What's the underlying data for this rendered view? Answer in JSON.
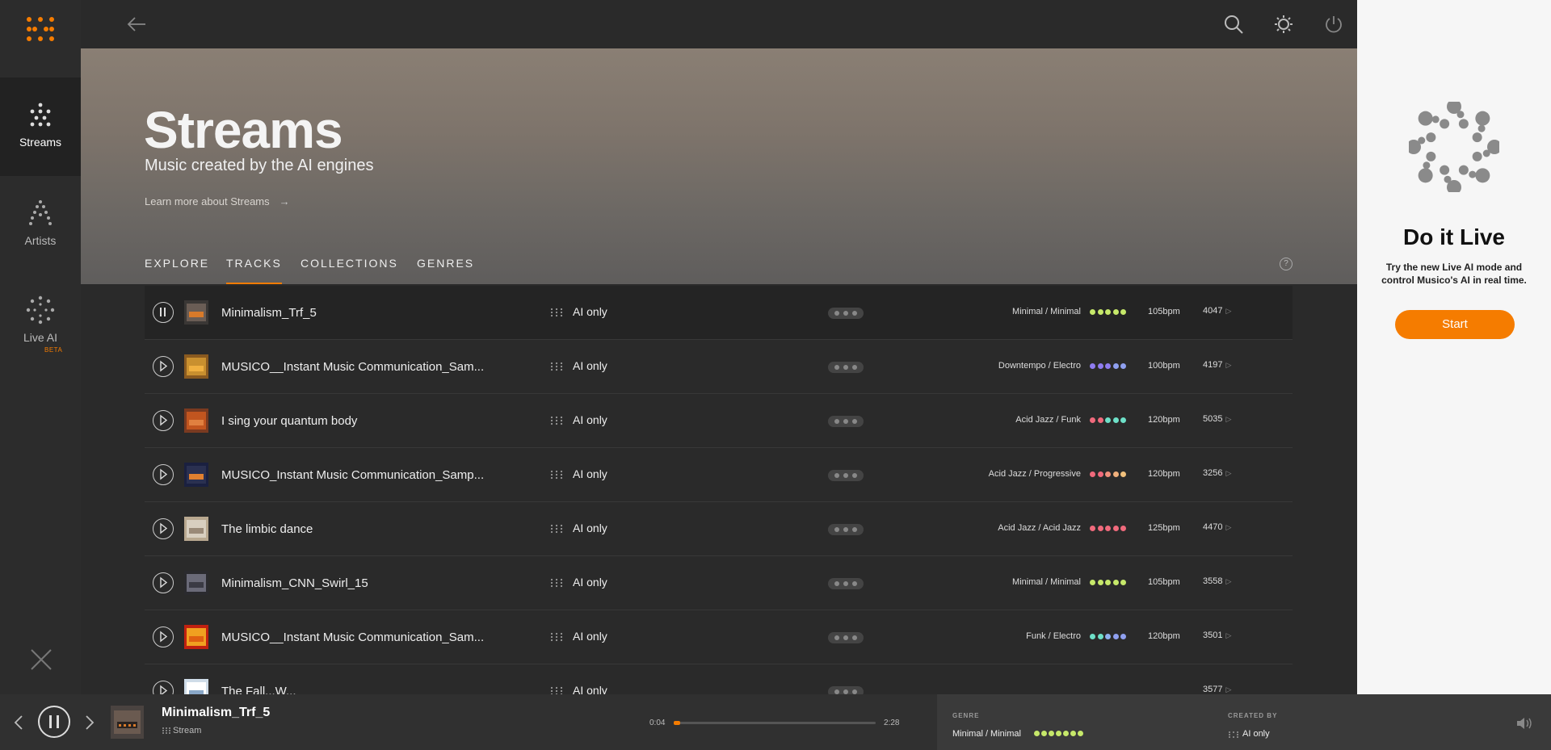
{
  "rail": {
    "items": [
      {
        "label": "Streams"
      },
      {
        "label": "Artists"
      },
      {
        "label": "Live AI",
        "badge": "BETA"
      }
    ]
  },
  "hero": {
    "title": "Streams",
    "subtitle": "Music created by the AI engines",
    "learn_more": "Learn more about Streams",
    "help": "?",
    "tabs": [
      {
        "label": "EXPLORE"
      },
      {
        "label": "TRACKS",
        "active": true
      },
      {
        "label": "COLLECTIONS"
      },
      {
        "label": "GENRES"
      }
    ]
  },
  "tracks": [
    {
      "title": "Minimalism_Trf_5",
      "creator": "AI only",
      "genre": "Minimal / Minimal",
      "colors": [
        "#c6e86a",
        "#c6e86a",
        "#c6e86a",
        "#c6e86a",
        "#c6e86a"
      ],
      "bpm": "105bpm",
      "plays": "4047",
      "playing": true
    },
    {
      "title": "MUSICO__Instant Music Communication_Sam...",
      "creator": "AI only",
      "genre": "Downtempo / Electro",
      "colors": [
        "#8f7cf0",
        "#8f7cf0",
        "#8f7cf0",
        "#8fa0f0",
        "#8fa0f0"
      ],
      "bpm": "100bpm",
      "plays": "4197"
    },
    {
      "title": "I sing your quantum body",
      "creator": "AI only",
      "genre": "Acid Jazz / Funk",
      "colors": [
        "#f06a7c",
        "#f06a7c",
        "#6ee0c8",
        "#6ee0c8",
        "#6ee0c8"
      ],
      "bpm": "120bpm",
      "plays": "5035"
    },
    {
      "title": "MUSICO_Instant Music Communication_Samp...",
      "creator": "AI only",
      "genre": "Acid Jazz / Progressive",
      "colors": [
        "#f06a7c",
        "#f06a7c",
        "#f0907c",
        "#f0b07c",
        "#f0c07c"
      ],
      "bpm": "120bpm",
      "plays": "3256"
    },
    {
      "title": "The limbic dance",
      "creator": "AI only",
      "genre": "Acid Jazz / Acid Jazz",
      "colors": [
        "#f06a7c",
        "#f06a7c",
        "#f06a7c",
        "#f06a7c",
        "#f06a7c"
      ],
      "bpm": "125bpm",
      "plays": "4470"
    },
    {
      "title": "Minimalism_CNN_Swirl_15",
      "creator": "AI only",
      "genre": "Minimal / Minimal",
      "colors": [
        "#c6e86a",
        "#c6e86a",
        "#c6e86a",
        "#c6e86a",
        "#c6e86a"
      ],
      "bpm": "105bpm",
      "plays": "3558"
    },
    {
      "title": "MUSICO__Instant Music Communication_Sam...",
      "creator": "AI only",
      "genre": "Funk / Electro",
      "colors": [
        "#6ee0c8",
        "#6ee0c8",
        "#8fb0f0",
        "#8fa0f0",
        "#8fa0f0"
      ],
      "bpm": "120bpm",
      "plays": "3501"
    },
    {
      "title": "The Fall...W...",
      "creator": "AI only",
      "genre": "",
      "colors": [],
      "bpm": "",
      "plays": "3577"
    }
  ],
  "live": {
    "title": "Do it Live",
    "description": "Try the new Live AI mode and control Musico's AI in real time.",
    "start": "Start"
  },
  "player": {
    "title": "Minimalism_Trf_5",
    "subtitle": "Stream",
    "elapsed": "0:04",
    "duration": "2:28",
    "progress": 0.03,
    "genre_label": "GENRE",
    "genre": "Minimal / Minimal",
    "created_label": "CREATED BY",
    "created": "AI only"
  },
  "colors": {
    "accent": "#f57c00",
    "background": "#2a2a2a",
    "panel": "#f6f6f6"
  }
}
